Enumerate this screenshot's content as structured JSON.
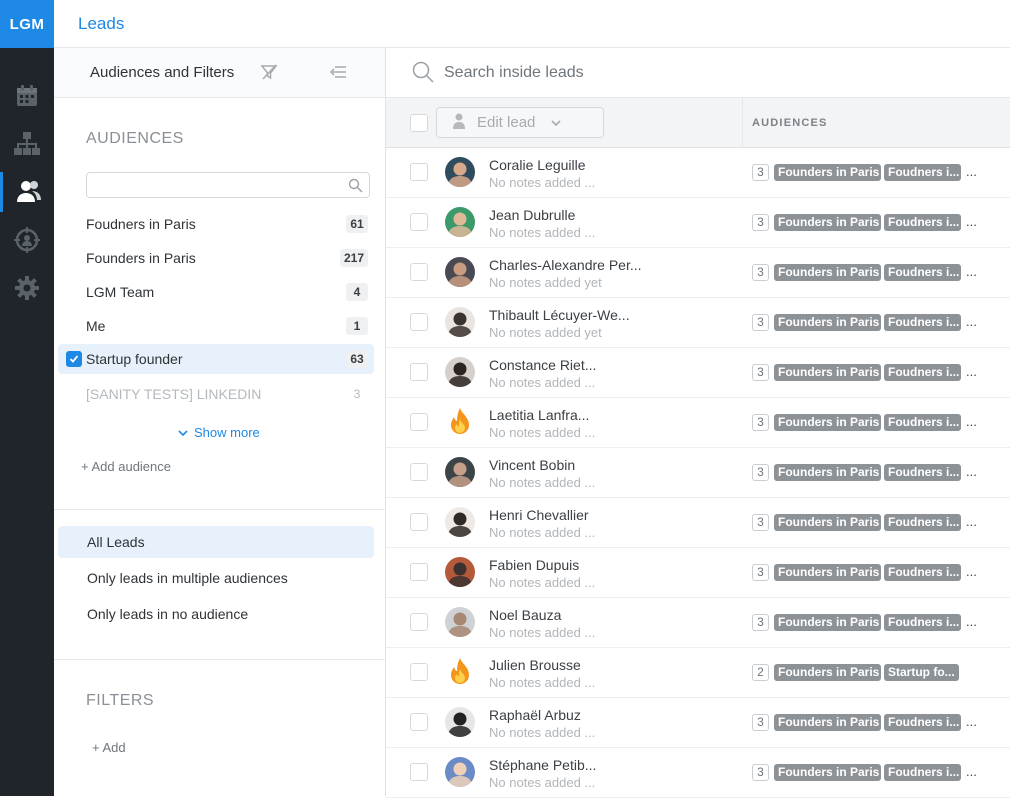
{
  "app": {
    "logo": "LGM",
    "page_title": "Leads"
  },
  "nav": {
    "items": [
      "calendar-icon",
      "sitemap-icon",
      "users-icon",
      "target-user-icon",
      "gear-icon"
    ],
    "active": "users-icon"
  },
  "left_panel": {
    "header": "Audiences and Filters",
    "audiences_title": "AUDIENCES",
    "audience_search_placeholder": "",
    "audiences": [
      {
        "label": "Foudners in Paris",
        "count": "61"
      },
      {
        "label": "Founders in Paris",
        "count": "217"
      },
      {
        "label": "LGM Team",
        "count": "4"
      },
      {
        "label": "Me",
        "count": "1"
      },
      {
        "label": "Startup founder",
        "count": "63"
      },
      {
        "label": "[SANITY TESTS] LINKEDIN",
        "count": "3"
      }
    ],
    "show_more": "Show more",
    "add_audience": "+ Add audience",
    "lead_filters": [
      "All Leads",
      "Only leads in multiple audiences",
      "Only leads in no audience"
    ],
    "filters_title": "FILTERS",
    "add_filter": "+ Add"
  },
  "main": {
    "search_placeholder": "Search inside leads",
    "edit_lead": "Edit lead",
    "audiences_header": "AUDIENCES",
    "more": "...",
    "leads": [
      {
        "name": "Coralie Leguille",
        "note": "No notes added ...",
        "count": "3",
        "tags": [
          "Founders in Paris",
          "Foudners i..."
        ],
        "avatar": "photo"
      },
      {
        "name": "Jean Dubrulle",
        "note": "No notes added ...",
        "count": "3",
        "tags": [
          "Founders in Paris",
          "Foudners i..."
        ],
        "avatar": "photo"
      },
      {
        "name": "Charles-Alexandre Per...",
        "note": "No notes added yet",
        "count": "3",
        "tags": [
          "Founders in Paris",
          "Foudners i..."
        ],
        "avatar": "photo"
      },
      {
        "name": "Thibault Lécuyer-We...",
        "note": "No notes added yet",
        "count": "3",
        "tags": [
          "Founders in Paris",
          "Foudners i..."
        ],
        "avatar": "photo"
      },
      {
        "name": "Constance Riet...",
        "note": "No notes added ...",
        "count": "3",
        "tags": [
          "Founders in Paris",
          "Foudners i..."
        ],
        "avatar": "photo"
      },
      {
        "name": "Laetitia Lanfra...",
        "note": "No notes added ...",
        "count": "3",
        "tags": [
          "Founders in Paris",
          "Foudners i..."
        ],
        "avatar": "fire"
      },
      {
        "name": "Vincent Bobin",
        "note": "No notes added ...",
        "count": "3",
        "tags": [
          "Founders in Paris",
          "Foudners i..."
        ],
        "avatar": "photo"
      },
      {
        "name": "Henri Chevallier",
        "note": "No notes added ...",
        "count": "3",
        "tags": [
          "Founders in Paris",
          "Foudners i..."
        ],
        "avatar": "photo"
      },
      {
        "name": "Fabien Dupuis",
        "note": "No notes added ...",
        "count": "3",
        "tags": [
          "Founders in Paris",
          "Foudners i..."
        ],
        "avatar": "photo"
      },
      {
        "name": "Noel Bauza",
        "note": "No notes added ...",
        "count": "3",
        "tags": [
          "Founders in Paris",
          "Foudners i..."
        ],
        "avatar": "photo"
      },
      {
        "name": "Julien Brousse",
        "note": "No notes added ...",
        "count": "2",
        "tags": [
          "Founders in Paris",
          "Startup fo..."
        ],
        "avatar": "fire"
      },
      {
        "name": "Raphaël Arbuz",
        "note": "No notes added ...",
        "count": "3",
        "tags": [
          "Founders in Paris",
          "Foudners i..."
        ],
        "avatar": "photo"
      },
      {
        "name": "Stéphane Petib...",
        "note": "No notes added ...",
        "count": "3",
        "tags": [
          "Founders in Paris",
          "Foudners i..."
        ],
        "avatar": "photo"
      }
    ]
  },
  "colors": {
    "accent": "#1e88e5",
    "sidebar": "#1f252a",
    "tag": "#8d9297"
  }
}
